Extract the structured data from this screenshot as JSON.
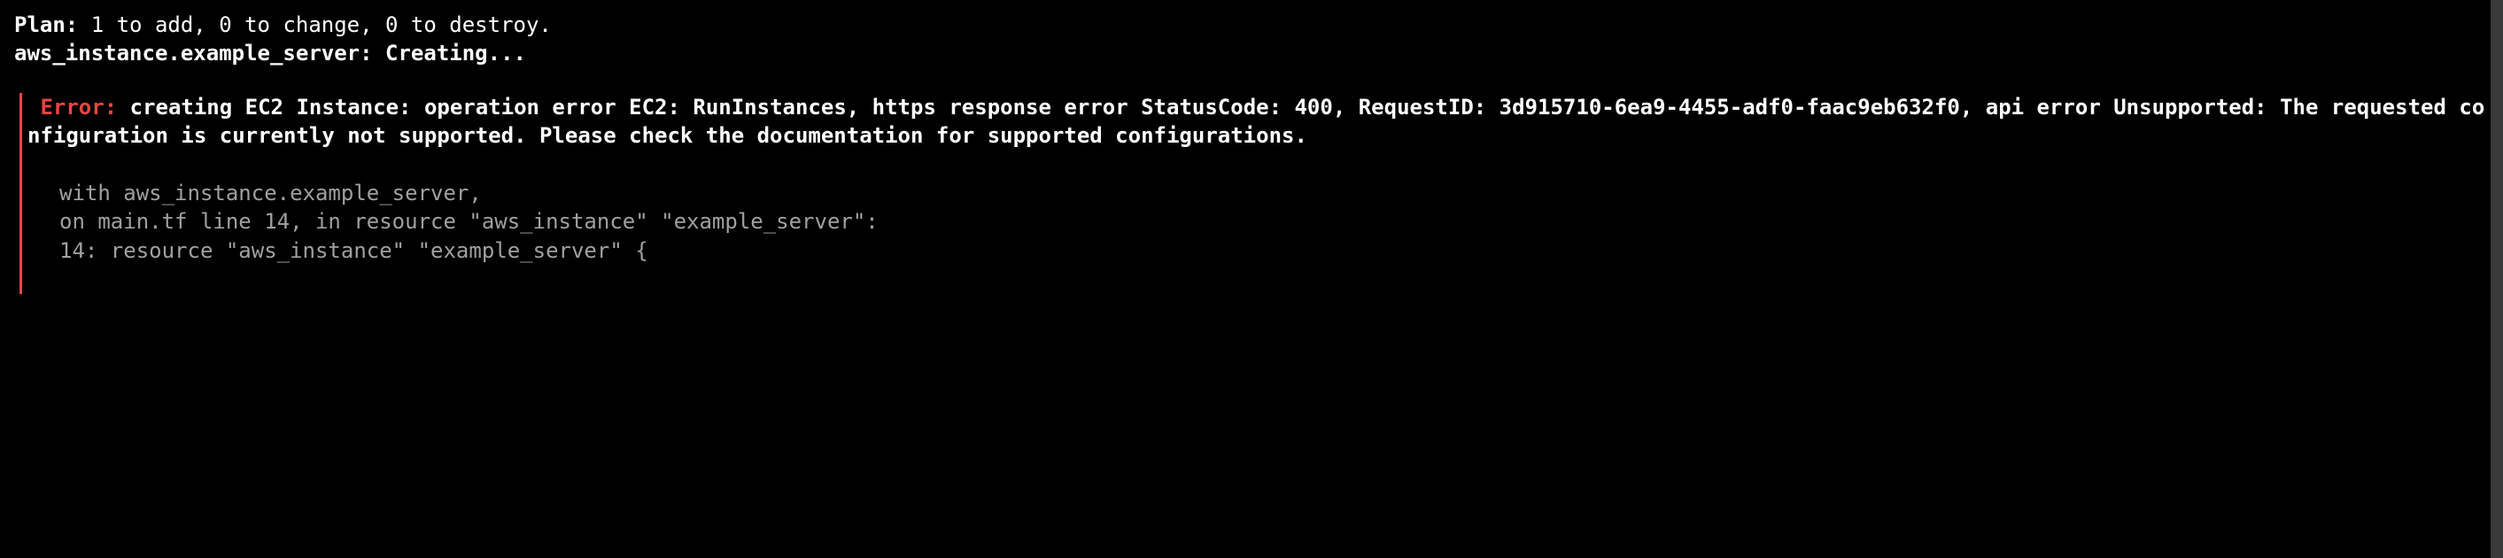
{
  "plan": {
    "label": "Plan:",
    "summary": " 1 to add, 0 to change, 0 to destroy."
  },
  "creating": "aws_instance.example_server: Creating...",
  "error": {
    "label": "Error:",
    "message": " creating EC2 Instance: operation error EC2: RunInstances, https response error StatusCode: 400, RequestID: 3d915710-6ea9-4455-adf0-faac9eb632f0, api error Unsupported: The requested configuration is currently not supported. Please check the documentation for supported configurations.",
    "context_with": "  with aws_instance.example_server,",
    "context_on": "  on main.tf line 14, in resource \"aws_instance\" \"example_server\":",
    "context_code": "  14: resource \"aws_instance\" \"example_server\" {"
  }
}
